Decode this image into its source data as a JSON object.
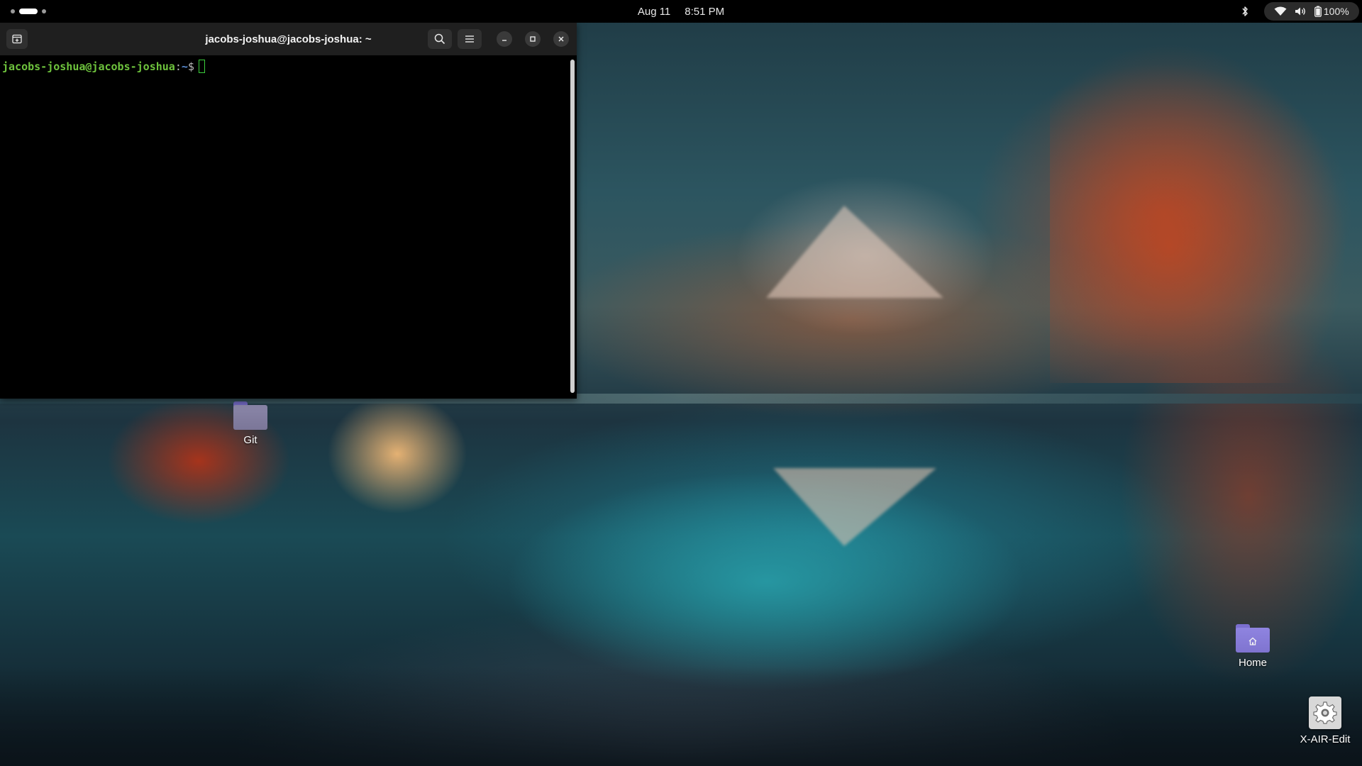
{
  "topbar": {
    "date": "Aug 11",
    "time": "8:51 PM",
    "battery_percent": "100%",
    "workspaces": {
      "count": 3,
      "active_index": 1
    },
    "tray_icons": [
      "bluetooth-icon",
      "wifi-icon",
      "volume-icon",
      "battery-icon"
    ]
  },
  "terminal": {
    "title": "jacobs-joshua@jacobs-joshua: ~",
    "prompt": {
      "user_host": "jacobs-joshua@jacobs-joshua",
      "separator": ":",
      "path": "~",
      "symbol": "$"
    },
    "buttons": [
      "new-tab-icon",
      "search-icon",
      "hamburger-menu-icon",
      "minimize-icon",
      "maximize-icon",
      "close-icon"
    ],
    "colors": {
      "prompt_user": "#6ec33d",
      "prompt_path": "#5b8ed6",
      "cursor": "#3ccf3c",
      "header_bg": "#1f1f1f",
      "body_bg": "#000000"
    }
  },
  "desktop": {
    "icons": [
      {
        "label": "Git",
        "icon": "folder-icon"
      },
      {
        "label": "Home",
        "icon": "home-folder-icon"
      },
      {
        "label": "X-AIR-Edit",
        "icon": "gear-icon"
      }
    ]
  }
}
